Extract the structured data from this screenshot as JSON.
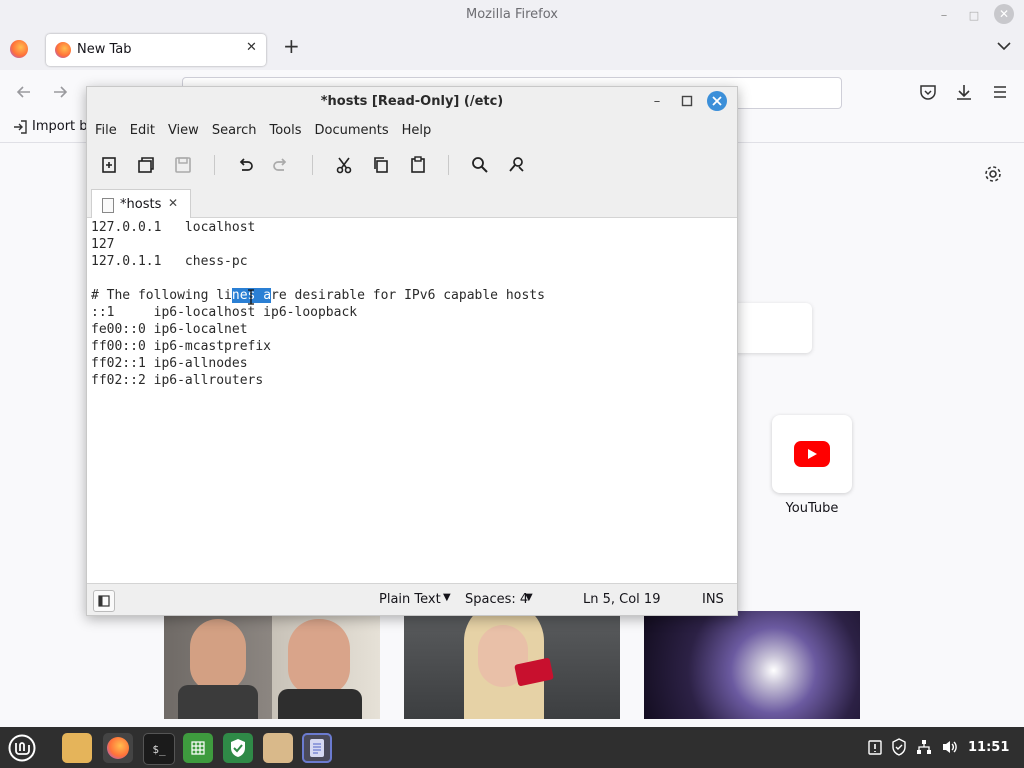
{
  "firefox": {
    "window_title": "Mozilla Firefox",
    "tab_label": "New Tab",
    "import_label": "Import b",
    "shortcut_label": "YouTube"
  },
  "gedit": {
    "title": "*hosts [Read-Only] (/etc)",
    "menu": [
      "File",
      "Edit",
      "View",
      "Search",
      "Tools",
      "Documents",
      "Help"
    ],
    "tab_label": "*hosts",
    "lines": [
      "127.0.0.1   localhost",
      "127",
      "127.0.1.1   chess-pc",
      "",
      "# The following lines are desirable for IPv6 capable hosts",
      "::1     ip6-localhost ip6-loopback",
      "fe00::0 ip6-localnet",
      "ff00::0 ip6-mcastprefix",
      "ff02::1 ip6-allnodes",
      "ff02::2 ip6-allrouters"
    ],
    "selection": {
      "line": 4,
      "before": "# The following li",
      "selected": "nes a",
      "after": "re desirable for IPv6 capable hosts"
    },
    "status": {
      "language": "Plain Text",
      "spaces": "Spaces: 4",
      "position": "Ln 5, Col 19",
      "mode": "INS"
    }
  },
  "taskbar": {
    "clock": "11:51"
  },
  "colors": {
    "selection": "#2a7fd4",
    "close_button": "#3b8fd9",
    "youtube_red": "#ff0000"
  }
}
